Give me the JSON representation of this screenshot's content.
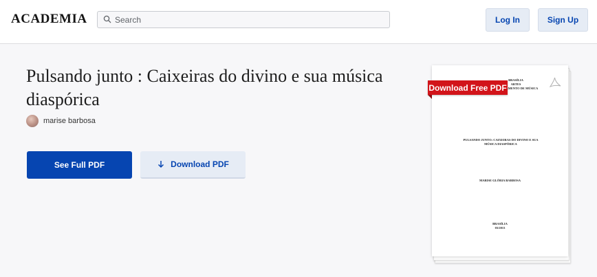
{
  "header": {
    "logo": "ACADEMIA",
    "search_placeholder": "Search",
    "login_label": "Log In",
    "signup_label": "Sign Up"
  },
  "paper": {
    "title": "Pulsando junto : Caixeiras do divino e sua música diaspórica",
    "author": "marise barbosa"
  },
  "actions": {
    "see_full_pdf": "See Full PDF",
    "download_pdf": "Download PDF"
  },
  "preview": {
    "ribbon_label": "Download Free PDF",
    "header_lines": [
      "BRASÍLIA",
      "ARTES",
      "DEPARTAMENTO DE MÚSICA"
    ],
    "title_lines": [
      "PULSANDO JUNTO: CAIXEIRAS DO DIVINO E SUA",
      "MÚSICA DIASPÓRICA"
    ],
    "author_line": "MARISE GLÓRIA BARBOSA",
    "place_lines": [
      "BRASÍLIA",
      "03/2013"
    ]
  },
  "colors": {
    "accent": "#0645b1",
    "ribbon": "#d2141a",
    "background": "#f7f7f9"
  }
}
